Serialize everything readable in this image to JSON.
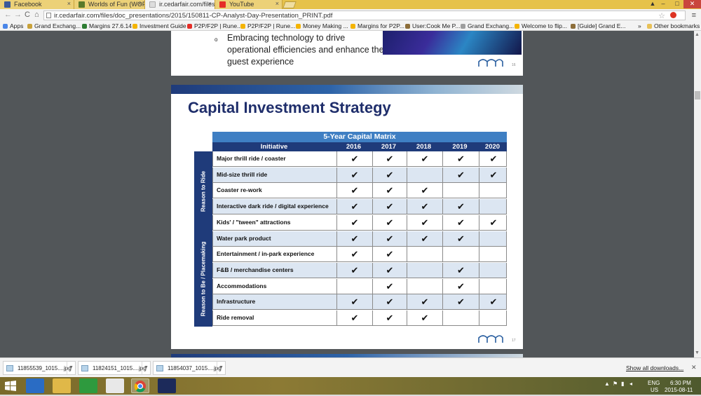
{
  "browser": {
    "tabs": [
      {
        "label": "Facebook",
        "active": false,
        "color": "#3b5998"
      },
      {
        "label": "Worlds of Fun (WOF",
        "active": false,
        "color": "#5a7a2a"
      },
      {
        "label": "ir.cedarfair.com/files/",
        "active": true,
        "color": "#dddddd"
      },
      {
        "label": "YouTube",
        "active": false,
        "color": "#e52d27"
      }
    ],
    "url": "ir.cedarfair.com/files/doc_presentations/2015/150811-CP-Analyst-Day-Presentation_PRINT.pdf",
    "bookmarks": [
      {
        "label": "Apps",
        "color": "#4a86e8"
      },
      {
        "label": "Grand Exchang...",
        "color": "#c9a23a"
      },
      {
        "label": "Margins 27.6.14",
        "color": "#2e7d32"
      },
      {
        "label": "Investment Guide",
        "color": "#f4b400"
      },
      {
        "label": "P2P/F2P | Rune...",
        "color": "#e52d27"
      },
      {
        "label": "P2P/F2P | Rune...",
        "color": "#f4b400"
      },
      {
        "label": "Money Making ...",
        "color": "#f4b400"
      },
      {
        "label": "Margins for P2P...",
        "color": "#f4b400"
      },
      {
        "label": "User:Cook Me P...",
        "color": "#8d6e3a"
      },
      {
        "label": "Grand Exchang...",
        "color": "#9e9e9e"
      },
      {
        "label": "Welcome to flip...",
        "color": "#f4b400"
      },
      {
        "label": "[Guide] Grand E...",
        "color": "#8d6e3a"
      }
    ],
    "bookmarks_overflow": "»",
    "other_bookmarks": "Other bookmarks"
  },
  "prev_page": {
    "bullet": "o",
    "text": "Embracing technology to drive operational efficiencies and enhance the guest experience",
    "page_number": "16"
  },
  "slide": {
    "title": "Capital Investment Strategy",
    "page_number": "17",
    "matrix_title": "5-Year Capital Matrix",
    "columns": [
      "Initiative",
      "2016",
      "2017",
      "2018",
      "2019",
      "2020"
    ],
    "groups": [
      {
        "label": "Reason to Ride",
        "rows": 5
      },
      {
        "label": "Reason to Be / Placemaking",
        "rows": 6
      }
    ],
    "check": "✔",
    "rows": [
      {
        "initiative": "Major thrill ride / coaster",
        "marks": [
          true,
          true,
          true,
          true,
          true
        ]
      },
      {
        "initiative": "Mid-size thrill ride",
        "marks": [
          true,
          true,
          false,
          true,
          true
        ]
      },
      {
        "initiative": "Coaster re-work",
        "marks": [
          true,
          true,
          true,
          false,
          false
        ]
      },
      {
        "initiative": "Interactive dark ride / digital experience",
        "marks": [
          true,
          true,
          true,
          true,
          false
        ]
      },
      {
        "initiative": "Kids' / \"tween\" attractions",
        "marks": [
          true,
          true,
          true,
          true,
          true
        ]
      },
      {
        "initiative": "Water park product",
        "marks": [
          true,
          true,
          true,
          true,
          false
        ]
      },
      {
        "initiative": "Entertainment / in-park experience",
        "marks": [
          true,
          true,
          false,
          false,
          false
        ]
      },
      {
        "initiative": "F&B / merchandise centers",
        "marks": [
          true,
          true,
          false,
          true,
          false
        ]
      },
      {
        "initiative": "Accommodations",
        "marks": [
          false,
          true,
          false,
          true,
          false
        ]
      },
      {
        "initiative": "Infrastructure",
        "marks": [
          true,
          true,
          true,
          true,
          true
        ]
      },
      {
        "initiative": "Ride removal",
        "marks": [
          true,
          true,
          true,
          false,
          false
        ]
      }
    ]
  },
  "downloads": {
    "items": [
      "11855539_1015....jpg",
      "11824151_1015....jpg",
      "11854037_1015....jpg"
    ],
    "show_all": "Show all downloads...",
    "close": "✕"
  },
  "taskbar": {
    "lang": "ENG",
    "region": "US",
    "time": "6:30 PM",
    "date": "2015-08-11"
  }
}
